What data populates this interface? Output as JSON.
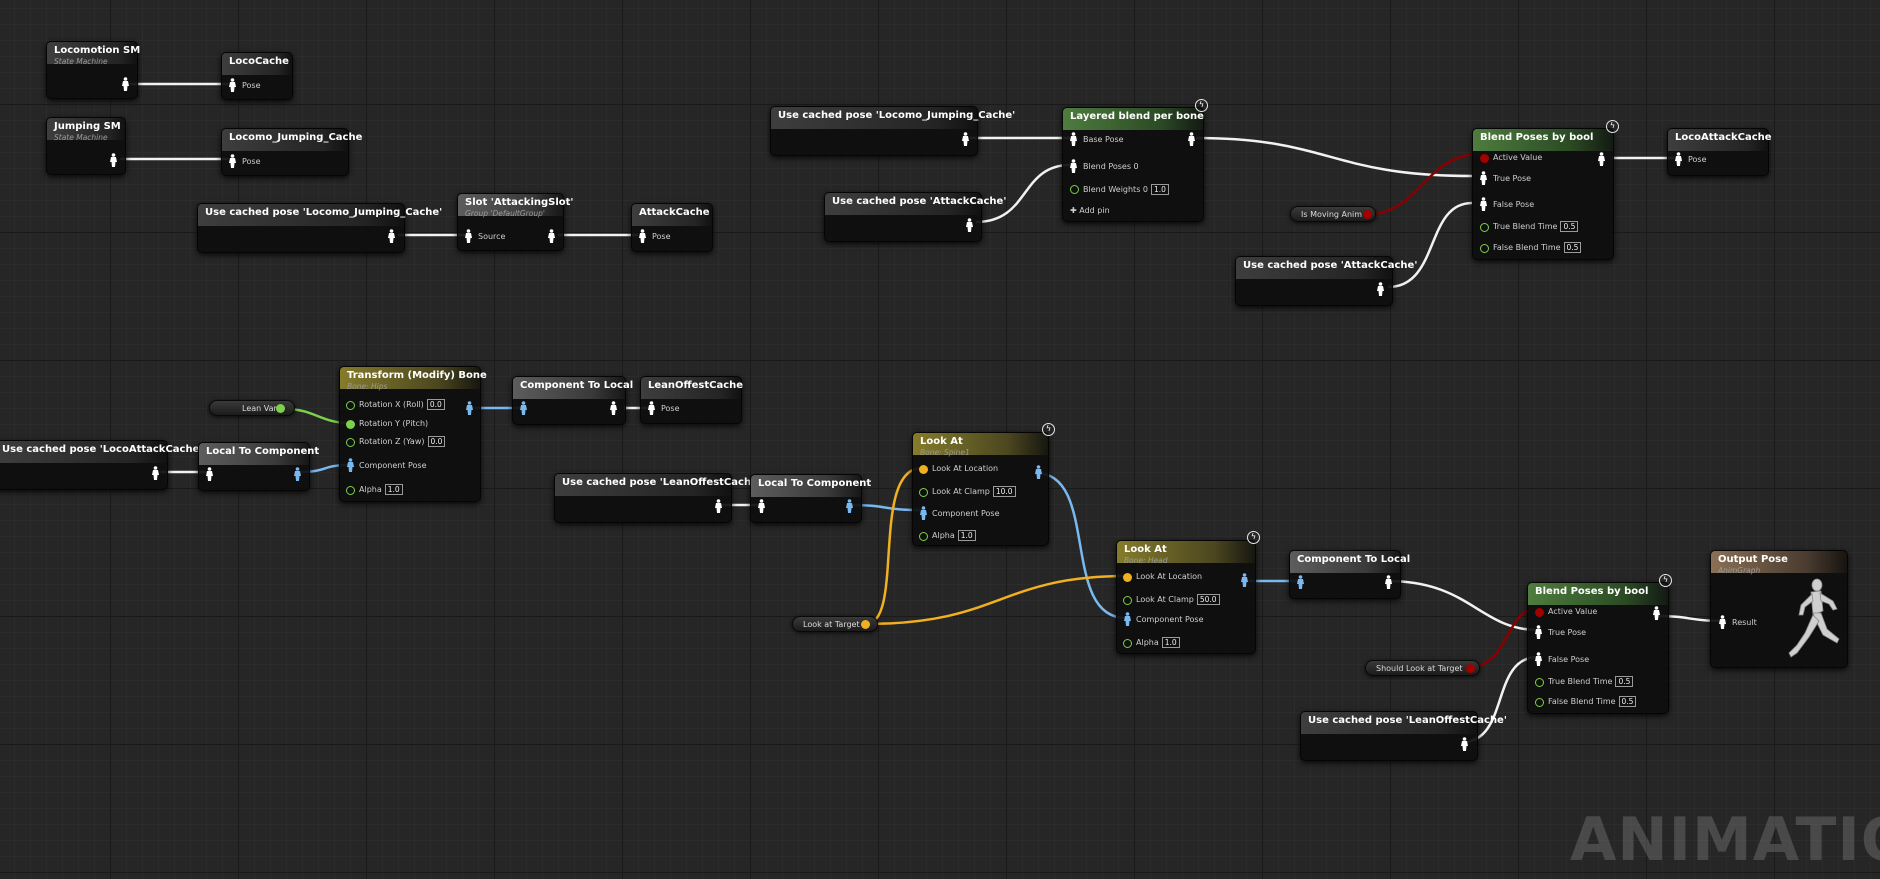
{
  "app": {
    "graph_type": "Animation Graph",
    "watermark": "ANIMATION"
  },
  "nodes": {
    "locomotion_sm": {
      "title": "Locomotion SM",
      "subtitle": "State Machine"
    },
    "loco_cache": {
      "title": "LocoCache",
      "pin": "Pose"
    },
    "jumping_sm": {
      "title": "Jumping SM",
      "subtitle": "State Machine"
    },
    "loco_jumping_cache": {
      "title": "Locomo_Jumping_Cache",
      "pin": "Pose"
    },
    "use_cached_jump_1": {
      "title": "Use cached pose 'Locomo_Jumping_Cache'"
    },
    "slot_attacking": {
      "title": "Slot 'AttackingSlot'",
      "subtitle": "Group 'DefaultGroup'",
      "pin": "Source"
    },
    "attack_cache": {
      "title": "AttackCache",
      "pin": "Pose"
    },
    "use_cached_jump_2": {
      "title": "Use cached pose 'Locomo_Jumping_Cache'"
    },
    "use_cached_attack_1": {
      "title": "Use cached pose 'AttackCache'"
    },
    "layered_blend": {
      "title": "Layered blend per bone",
      "base_pose": "Base Pose",
      "blend_poses": "Blend Poses 0",
      "blend_weights": "Blend Weights 0",
      "blend_weights_val": "1.0",
      "add_pin": "Add pin"
    },
    "is_moving_var": {
      "label": "Is Moving Anim"
    },
    "use_cached_attack_2": {
      "title": "Use cached pose 'AttackCache'"
    },
    "blend_bool_1": {
      "title": "Blend Poses by bool",
      "active": "Active Value",
      "true_pose": "True Pose",
      "false_pose": "False Pose",
      "true_time": "True Blend Time",
      "true_time_val": "0.5",
      "false_time": "False Blend Time",
      "false_time_val": "0.5"
    },
    "loco_attack_cache": {
      "title": "LocoAttackCache",
      "pin": "Pose"
    },
    "lean_var": {
      "label": "Lean Var"
    },
    "transform_bone": {
      "title": "Transform (Modify) Bone",
      "subtitle": "Bone: Hips",
      "rot_x": "Rotation X (Roll)",
      "rot_x_val": "0.0",
      "rot_y": "Rotation Y (Pitch)",
      "rot_z": "Rotation Z (Yaw)",
      "rot_z_val": "0.0",
      "comp_pose": "Component Pose",
      "alpha": "Alpha",
      "alpha_val": "1.0"
    },
    "comp_to_local_1": {
      "title": "Component To Local"
    },
    "lean_offset_cache": {
      "title": "LeanOffestCache",
      "pin": "Pose"
    },
    "use_cached_loco_attack": {
      "title": "Use cached pose 'LocoAttackCache'"
    },
    "local_to_comp_1": {
      "title": "Local To Component"
    },
    "use_cached_lean_1": {
      "title": "Use cached pose 'LeanOffestCache'"
    },
    "local_to_comp_2": {
      "title": "Local To Component"
    },
    "look_at_1": {
      "title": "Look At",
      "subtitle": "Bone: Spine1",
      "loc": "Look At Location",
      "clamp": "Look At Clamp",
      "clamp_val": "10.0",
      "comp_pose": "Component Pose",
      "alpha": "Alpha",
      "alpha_val": "1.0"
    },
    "look_at_target_var": {
      "label": "Look at Target"
    },
    "look_at_2": {
      "title": "Look At",
      "subtitle": "Bone: Head",
      "loc": "Look At Location",
      "clamp": "Look At Clamp",
      "clamp_val": "50.0",
      "comp_pose": "Component Pose",
      "alpha": "Alpha",
      "alpha_val": "1.0"
    },
    "comp_to_local_2": {
      "title": "Component To Local"
    },
    "should_look_var": {
      "label": "Should Look at Target"
    },
    "use_cached_lean_2": {
      "title": "Use cached pose 'LeanOffestCache'"
    },
    "blend_bool_2": {
      "title": "Blend Poses by bool",
      "active": "Active Value",
      "true_pose": "True Pose",
      "false_pose": "False Pose",
      "true_time": "True Blend Time",
      "true_time_val": "0.5",
      "false_time": "False Blend Time",
      "false_time_val": "0.5"
    },
    "output_pose": {
      "title": "Output Pose",
      "subtitle": "AnimGraph",
      "pin": "Result"
    }
  },
  "colors": {
    "pose_wire": "#f2f2f2",
    "component_wire": "#7ab8f0",
    "vector_wire": "#f0b020",
    "bool_wire": "#8a0000",
    "float_wire": "#7bd14a"
  }
}
